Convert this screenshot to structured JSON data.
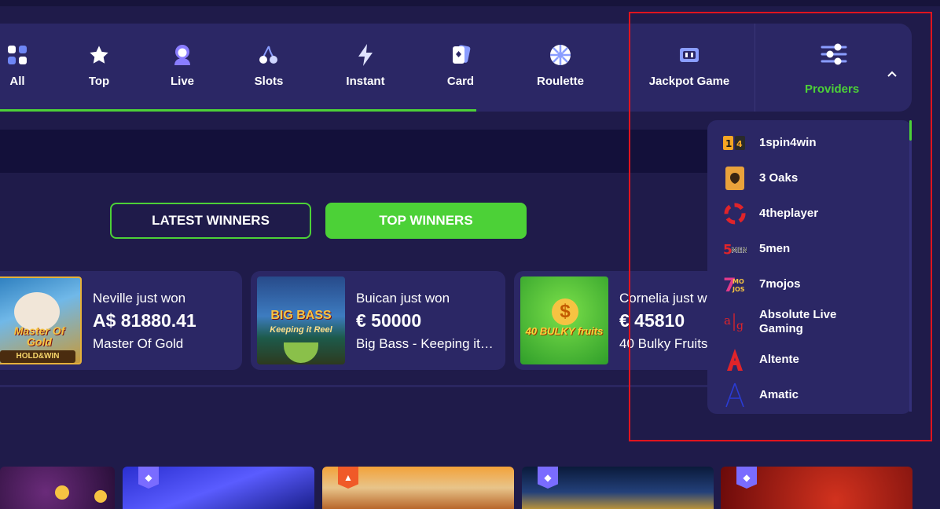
{
  "nav": {
    "items": [
      {
        "label": "All",
        "icon": "grid-icon"
      },
      {
        "label": "Top",
        "icon": "star-icon"
      },
      {
        "label": "Live",
        "icon": "person-icon"
      },
      {
        "label": "Slots",
        "icon": "cherry-icon"
      },
      {
        "label": "Instant",
        "icon": "lightning-icon"
      },
      {
        "label": "Card",
        "icon": "cards-icon"
      },
      {
        "label": "Roulette",
        "icon": "roulette-icon"
      },
      {
        "label": "Jackpot Game",
        "icon": "jackpot-icon"
      }
    ],
    "active": "All",
    "providers_label": "Providers",
    "accent": "#4cd137"
  },
  "winners": {
    "tabs": {
      "latest": "LATEST WINNERS",
      "top": "TOP WINNERS"
    },
    "active_tab": "TOP WINNERS",
    "cards": [
      {
        "who": "Neville just won",
        "amount": "A$ 81880.41",
        "game": "Master Of Gold",
        "thumb_text": "Master Of Gold",
        "thumb_badge": "HOLD&WIN"
      },
      {
        "who": "Buican just won",
        "amount": "€ 50000",
        "game": "Big Bass - Keeping it…",
        "thumb_text": "BIG BASS",
        "thumb_sub": "Keeping it Reel"
      },
      {
        "who": "Cornelia just won",
        "amount": "€ 45810",
        "game": "40 Bulky Fruits",
        "thumb_text": "40 BULKY fruits"
      }
    ]
  },
  "providers": [
    {
      "name": "1spin4win",
      "logo": "1spin4win-logo"
    },
    {
      "name": "3 Oaks",
      "logo": "3oaks-logo"
    },
    {
      "name": "4theplayer",
      "logo": "4theplayer-logo"
    },
    {
      "name": "5men",
      "logo": "5men-logo"
    },
    {
      "name": "7mojos",
      "logo": "7mojos-logo"
    },
    {
      "name": "Absolute Live Gaming",
      "logo": "alg-logo"
    },
    {
      "name": "Altente",
      "logo": "altente-logo"
    },
    {
      "name": "Amatic",
      "logo": "amatic-logo"
    }
  ],
  "colors": {
    "background": "#1f1b4a",
    "panel": "#2b2765",
    "green": "#4cd137",
    "highlight": "#e0141e"
  }
}
